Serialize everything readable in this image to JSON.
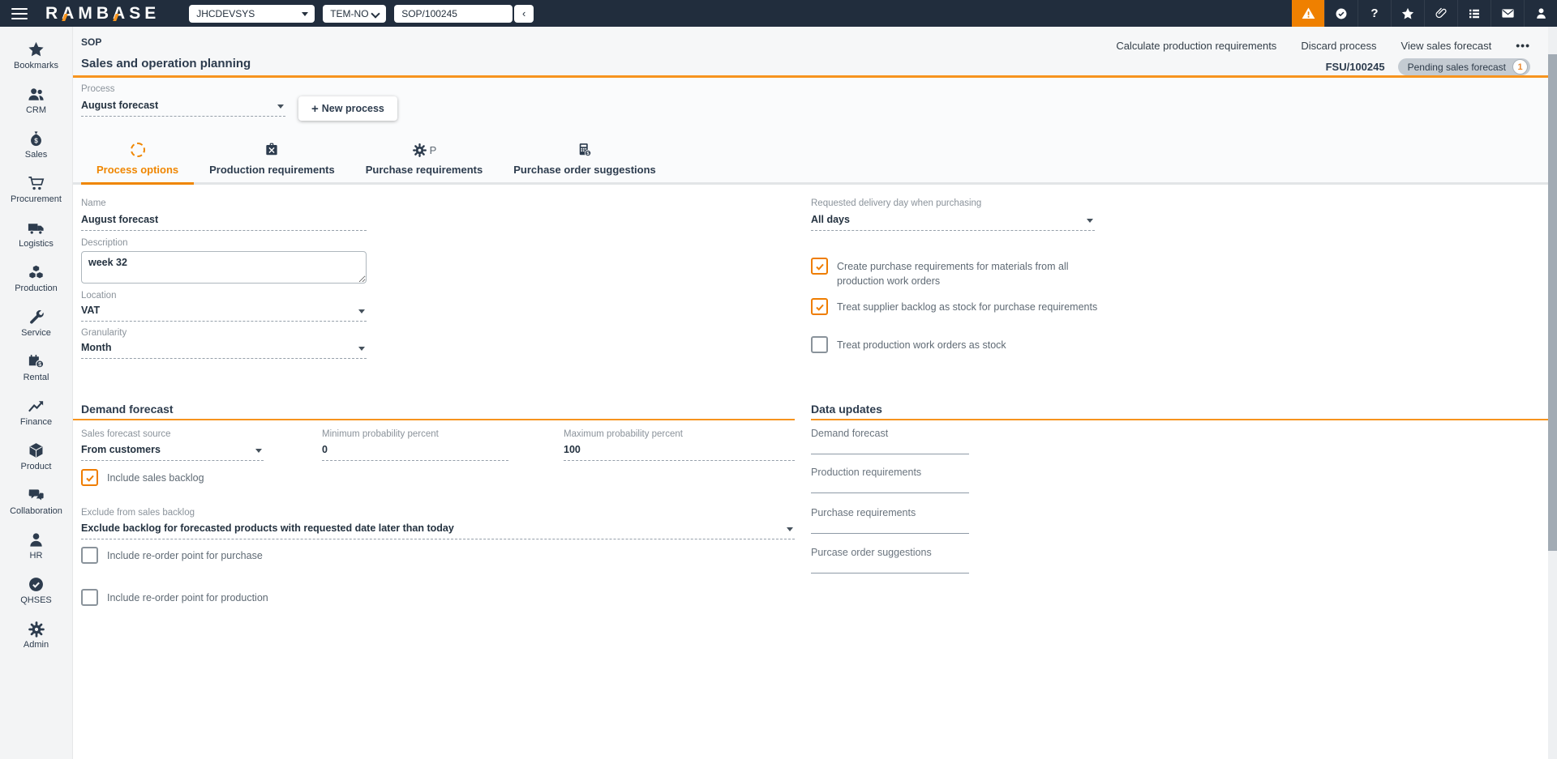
{
  "topbar": {
    "logo_r1": "R",
    "logo_a1": "A",
    "logo_m": "M",
    "logo_b": "B",
    "logo_a2": "A",
    "logo_s": "S",
    "logo_e": "E",
    "system_dropdown": "JHCDEVSYS",
    "company_dropdown": "TEM-NO",
    "document_input": "SOP/100245",
    "back_button": "‹"
  },
  "sidebar": {
    "items": [
      {
        "label": "Bookmarks"
      },
      {
        "label": "CRM"
      },
      {
        "label": "Sales"
      },
      {
        "label": "Procurement"
      },
      {
        "label": "Logistics"
      },
      {
        "label": "Production"
      },
      {
        "label": "Service"
      },
      {
        "label": "Rental"
      },
      {
        "label": "Finance"
      },
      {
        "label": "Product"
      },
      {
        "label": "Collaboration"
      },
      {
        "label": "HR"
      },
      {
        "label": "QHSES"
      },
      {
        "label": "Admin"
      }
    ]
  },
  "header": {
    "app_code": "SOP",
    "title": "Sales and operation planning",
    "actions": [
      {
        "label": "Calculate production requirements"
      },
      {
        "label": "Discard process"
      },
      {
        "label": "View sales forecast"
      }
    ],
    "more": "•••",
    "document_id": "FSU/100245",
    "status": {
      "label": "Pending sales forecast",
      "count": "1"
    }
  },
  "process": {
    "label": "Process",
    "value": "August forecast",
    "new_button_plus": "+",
    "new_button": "New process"
  },
  "tabs": [
    {
      "label": "Process options"
    },
    {
      "label": "Production requirements"
    },
    {
      "label": "Purchase requirements",
      "icon_text": "P"
    },
    {
      "label": "Purchase order suggestions"
    }
  ],
  "options": {
    "name": {
      "label": "Name",
      "value": "August forecast"
    },
    "description": {
      "label": "Description",
      "value": "week 32"
    },
    "location": {
      "label": "Location",
      "value": "VAT"
    },
    "granularity": {
      "label": "Granularity",
      "value": "Month"
    },
    "requested_delivery_day": {
      "label": "Requested delivery day when purchasing",
      "value": "All days"
    },
    "create_purchase_requirements": {
      "label": "Create purchase requirements for materials from all production work orders",
      "checked": true
    },
    "treat_supplier_backlog": {
      "label": "Treat supplier backlog as stock for purchase requirements",
      "checked": true
    },
    "treat_production_work_orders": {
      "label": "Treat production work orders as stock",
      "checked": false
    }
  },
  "demand_forecast": {
    "title": "Demand forecast",
    "sales_forecast_source": {
      "label": "Sales forecast source",
      "value": "From customers"
    },
    "minimum_probability": {
      "label": "Minimum probability percent",
      "value": "0"
    },
    "maximum_probability": {
      "label": "Maximum probability percent",
      "value": "100"
    },
    "include_sales_backlog": {
      "label": "Include sales backlog",
      "checked": true
    },
    "exclude_from_sales_backlog": {
      "label": "Exclude from sales backlog",
      "value": "Exclude backlog for forecasted products with requested date later than today"
    },
    "include_reorder_purchase": {
      "label": "Include re-order point for purchase",
      "checked": false
    },
    "include_reorder_production": {
      "label": "Include re-order point for production",
      "checked": false
    }
  },
  "data_updates": {
    "title": "Data updates",
    "fields": [
      {
        "label": "Demand forecast"
      },
      {
        "label": "Production requirements"
      },
      {
        "label": "Purchase requirements"
      },
      {
        "label": "Purcase order suggestions"
      }
    ]
  },
  "colors": {
    "accent": "#f7941e",
    "topbar": "#212d3d",
    "navy": "#2d3c4e",
    "alert_bg": "#ef8000"
  }
}
